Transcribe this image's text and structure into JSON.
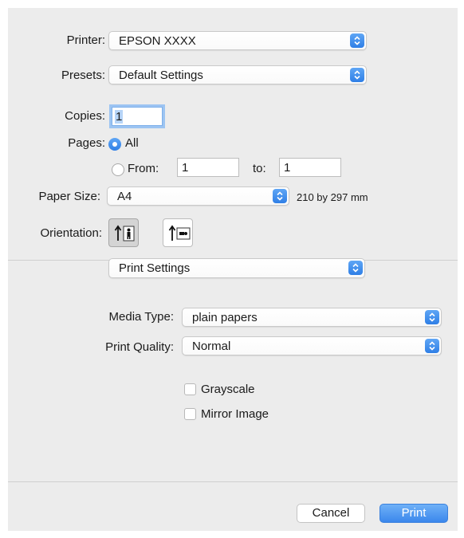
{
  "printer": {
    "label": "Printer:",
    "value": "EPSON XXXX"
  },
  "presets": {
    "label": "Presets:",
    "value": "Default Settings"
  },
  "copies": {
    "label": "Copies:",
    "value": "1"
  },
  "pages": {
    "label": "Pages:",
    "all_label": "All",
    "from_label": "From:",
    "from_value": "1",
    "to_label": "to:",
    "to_value": "1",
    "selected": "All"
  },
  "paper_size": {
    "label": "Paper Size:",
    "value": "A4",
    "dimensions": "210 by 297 mm"
  },
  "orientation": {
    "label": "Orientation:",
    "selected": "portrait"
  },
  "section": {
    "value": "Print Settings"
  },
  "media_type": {
    "label": "Media Type:",
    "value": "plain papers"
  },
  "print_quality": {
    "label": "Print Quality:",
    "value": "Normal"
  },
  "grayscale": {
    "label": "Grayscale",
    "checked": false
  },
  "mirror_image": {
    "label": "Mirror Image",
    "checked": false
  },
  "buttons": {
    "cancel": "Cancel",
    "print": "Print"
  },
  "colors": {
    "accent": "#3b87ec",
    "dialog_bg": "#ececec"
  }
}
